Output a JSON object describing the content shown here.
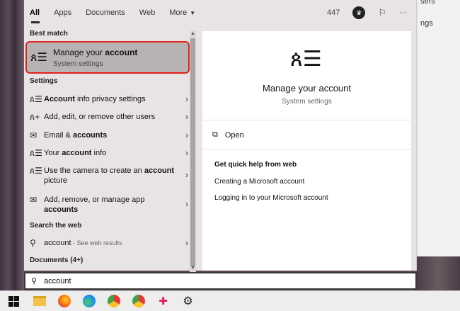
{
  "background": {
    "frag1": "sers",
    "frag2": "ngs"
  },
  "tabs": [
    {
      "label": "All"
    },
    {
      "label": "Apps"
    },
    {
      "label": "Documents"
    },
    {
      "label": "Web"
    },
    {
      "label": "More"
    }
  ],
  "topbar": {
    "points": "447",
    "more_label": "···"
  },
  "left": {
    "best_match_title": "Best match",
    "best_match": {
      "title_plain": "Manage your ",
      "title_bold": "account",
      "subtitle": "System settings"
    },
    "settings_title": "Settings",
    "settings_items": [
      {
        "bold": "Account",
        "rest": " info privacy settings"
      },
      {
        "pre": "Add, edit, or remove other users"
      },
      {
        "pre": "Email & ",
        "bold": "accounts"
      },
      {
        "pre": "Your ",
        "bold": "account",
        "rest": " info"
      },
      {
        "pre": "Use the camera to create an ",
        "bold": "account",
        "rest": " picture"
      },
      {
        "pre": "Add, remove, or manage app ",
        "bold": "accounts"
      }
    ],
    "web_title": "Search the web",
    "web_item": {
      "query": "account",
      "suffix": " - See web results"
    },
    "documents_title": "Documents (4+)"
  },
  "detail": {
    "title": "Manage your account",
    "subtitle": "System settings",
    "open_label": "Open",
    "help_title": "Get quick help from web",
    "links": [
      "Creating a Microsoft account",
      "Logging in to your Microsoft account"
    ]
  },
  "search": {
    "value": "account"
  },
  "colors": {
    "highlight_border": "#e02020",
    "best_match_bg": "#b8b3b3",
    "panel_bg": "#e8e4e4"
  },
  "taskbar": {
    "icons": [
      "windows-start-icon",
      "file-explorer-icon",
      "firefox-icon",
      "edge-icon",
      "chrome-icon",
      "chrome-alt-icon",
      "slack-icon",
      "settings-gear-icon"
    ]
  }
}
